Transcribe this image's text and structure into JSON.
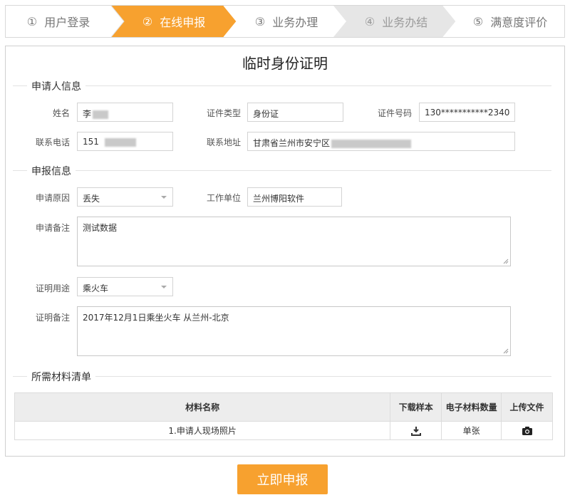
{
  "steps": [
    {
      "num": "①",
      "label": "用户登录",
      "state": "done"
    },
    {
      "num": "②",
      "label": "在线申报",
      "state": "active"
    },
    {
      "num": "③",
      "label": "业务办理",
      "state": "todo"
    },
    {
      "num": "④",
      "label": "业务办结",
      "state": "disabled"
    },
    {
      "num": "⑤",
      "label": "满意度评价",
      "state": "todo"
    }
  ],
  "form_title": "临时身份证明",
  "applicant_section": {
    "heading": "申请人信息",
    "name_label": "姓名",
    "name_value": "李",
    "idtype_label": "证件类型",
    "idtype_value": "身份证",
    "idno_label": "证件号码",
    "idno_value": "130***********2340",
    "phone_label": "联系电话",
    "phone_value": "151",
    "address_label": "联系地址",
    "address_value": "甘肃省兰州市安宁区"
  },
  "declare_section": {
    "heading": "申报信息",
    "reason_label": "申请原因",
    "reason_value": "丢失",
    "employer_label": "工作单位",
    "employer_value": "兰州博阳软件",
    "remark_label": "申请备注",
    "remark_value": "测试数据",
    "purpose_label": "证明用途",
    "purpose_value": "乘火车",
    "proof_remark_label": "证明备注",
    "proof_remark_value": "2017年12月1日乘坐火车 从兰州-北京"
  },
  "materials_section": {
    "heading": "所需材料清单",
    "columns": [
      "材料名称",
      "下载样本",
      "电子材料数量",
      "上传文件"
    ],
    "rows": [
      {
        "name": "1.申请人现场照片",
        "download_icon": "download-icon",
        "quantity": "单张",
        "upload_icon": "camera-icon"
      }
    ]
  },
  "submit_label": "立即申报",
  "colors": {
    "accent": "#f7a12f",
    "step_done_bg": "#ffffff",
    "step_disabled_bg": "#e6e6e6"
  }
}
